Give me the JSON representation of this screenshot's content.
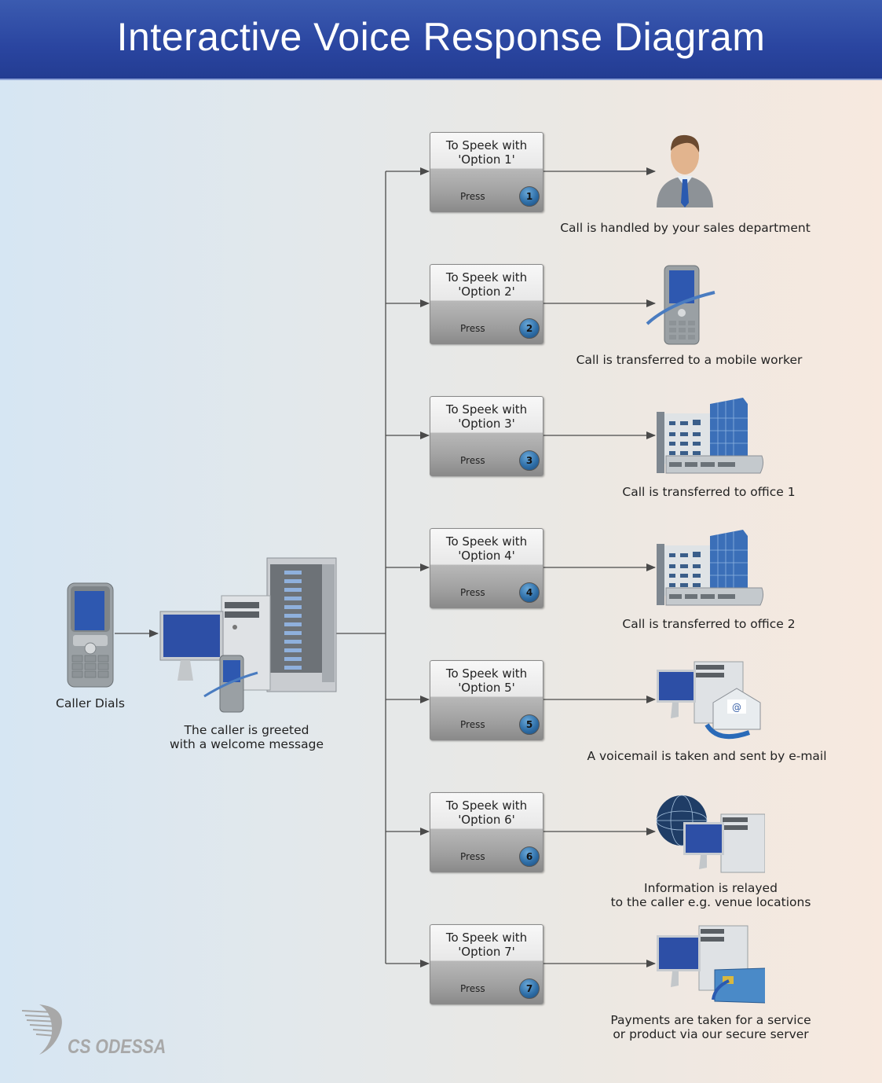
{
  "title": "Interactive Voice Response Diagram",
  "caller": {
    "label": "Caller Dials",
    "icon": "mobile-phone-icon"
  },
  "greeting": {
    "label": "The caller is greeted\nwith a welcome message",
    "icon": "ivr-server-icon"
  },
  "options": [
    {
      "title": "To Speek with\n'Option 1'",
      "press": "Press",
      "number": "1",
      "result": "Call is handled by your sales department",
      "icon": "businessman-icon"
    },
    {
      "title": "To Speek with\n'Option 2'",
      "press": "Press",
      "number": "2",
      "result": "Call is transferred to a mobile worker",
      "icon": "mobile-phone-icon"
    },
    {
      "title": "To Speek with\n'Option 3'",
      "press": "Press",
      "number": "3",
      "result": "Call is transferred to office 1",
      "icon": "office-building-icon"
    },
    {
      "title": "To Speek with\n'Option 4'",
      "press": "Press",
      "number": "4",
      "result": "Call is transferred to office 2",
      "icon": "office-building-icon"
    },
    {
      "title": "To Speek with\n'Option 5'",
      "press": "Press",
      "number": "5",
      "result": "A voicemail is taken and sent by e-mail",
      "icon": "email-server-icon"
    },
    {
      "title": "To Speek with\n'Option 6'",
      "press": "Press",
      "number": "6",
      "result": "Information is relayed\nto the caller e.g. venue locations",
      "icon": "globe-server-icon"
    },
    {
      "title": "To Speek with\n'Option 7'",
      "press": "Press",
      "number": "7",
      "result": "Payments are taken for a service\nor product via our secure server",
      "icon": "credit-card-server-icon"
    }
  ],
  "logo": {
    "text": "CS ODESSA"
  },
  "colors": {
    "header": "#2a45a0",
    "connector": "#4a4a4a",
    "badge": "#2f6fa8"
  }
}
